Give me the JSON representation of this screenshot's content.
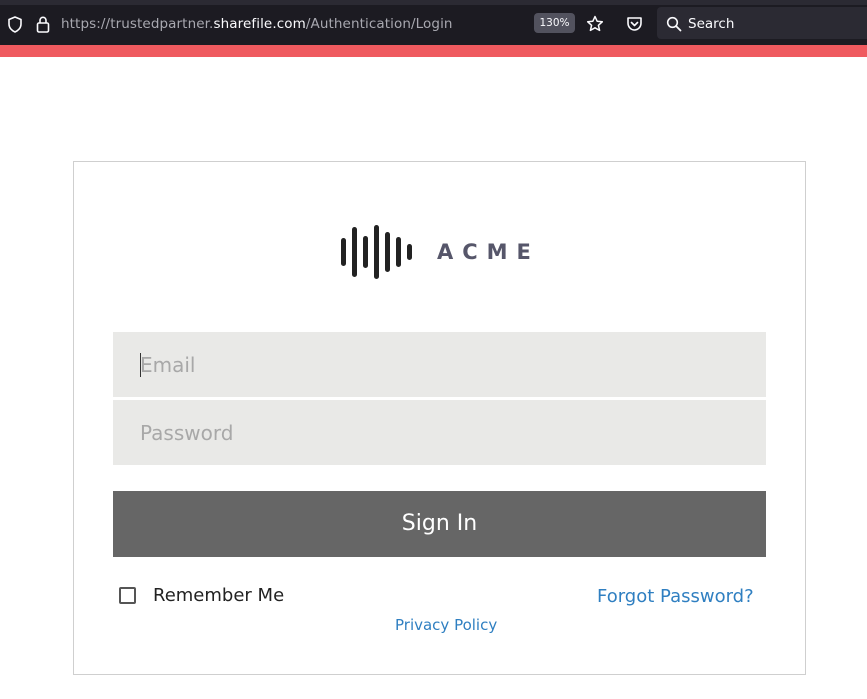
{
  "browser": {
    "url_prefix": "https://trustedpartner.",
    "url_domain": "sharefile.com",
    "url_path": "/Authentication/Login",
    "zoom": "130%",
    "search_placeholder": "Search",
    "icons": [
      "shield-icon",
      "lock-icon",
      "star-icon",
      "pocket-icon",
      "search-icon"
    ]
  },
  "colors": {
    "accent": "#ef5a5f",
    "button": "#666666",
    "link": "#2f7fc1",
    "field_bg": "#e9e9e7"
  },
  "logo": {
    "text": "ACME"
  },
  "form": {
    "email_placeholder": "Email",
    "email_value": "",
    "password_placeholder": "Password",
    "password_value": "",
    "signin_label": "Sign In",
    "remember_label": "Remember Me",
    "remember_checked": false,
    "forgot_label": "Forgot Password?",
    "privacy_label": "Privacy Policy"
  }
}
